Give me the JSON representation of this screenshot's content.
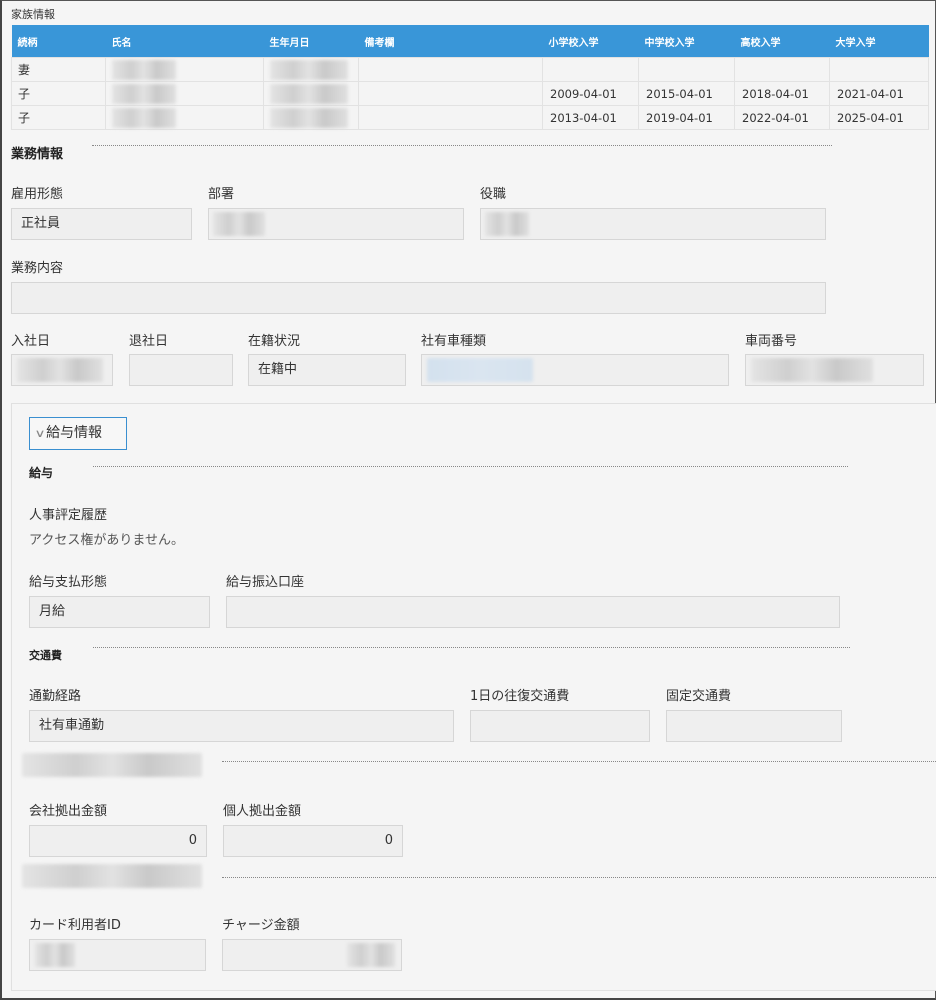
{
  "family": {
    "caption": "家族情報",
    "headers": [
      "続柄",
      "氏名",
      "生年月日",
      "備考欄",
      "小学校入学",
      "中学校入学",
      "高校入学",
      "大学入学"
    ],
    "rows": [
      {
        "relation": "妻",
        "name": "",
        "birthdate": "",
        "note": "",
        "elementary": "",
        "junior_high": "",
        "high_school": "",
        "university": ""
      },
      {
        "relation": "子",
        "name": "",
        "birthdate": "",
        "note": "",
        "elementary": "2009-04-01",
        "junior_high": "2015-04-01",
        "high_school": "2018-04-01",
        "university": "2021-04-01"
      },
      {
        "relation": "子",
        "name": "",
        "birthdate": "",
        "note": "",
        "elementary": "2013-04-01",
        "junior_high": "2019-04-01",
        "high_school": "2022-04-01",
        "university": "2025-04-01"
      }
    ]
  },
  "work": {
    "title": "業務情報",
    "employment_type": {
      "label": "雇用形態",
      "value": "正社員"
    },
    "department": {
      "label": "部署",
      "value": ""
    },
    "position": {
      "label": "役職",
      "value": ""
    },
    "job_description": {
      "label": "業務内容",
      "value": ""
    },
    "hire_date": {
      "label": "入社日",
      "value": ""
    },
    "leave_date": {
      "label": "退社日",
      "value": ""
    },
    "status": {
      "label": "在籍状況",
      "value": "在籍中"
    },
    "company_car_type": {
      "label": "社有車種類",
      "value": ""
    },
    "vehicle_number": {
      "label": "車両番号",
      "value": ""
    }
  },
  "salary_panel": {
    "toggle_label": "給与情報",
    "salary": {
      "title": "給与",
      "evaluation_history": {
        "label": "人事評定履歴",
        "message": "アクセス権がありません。"
      },
      "payment_type": {
        "label": "給与支払形態",
        "value": "月給"
      },
      "bank_account": {
        "label": "給与振込口座",
        "value": ""
      }
    },
    "transport": {
      "title": "交通費",
      "route": {
        "label": "通勤経路",
        "value": "社有車通勤"
      },
      "daily_round_trip": {
        "label": "1日の往復交通費",
        "value": ""
      },
      "fixed_fee": {
        "label": "固定交通費",
        "value": ""
      }
    },
    "contribution": {
      "company_amount": {
        "label": "会社拠出金額",
        "value": "0"
      },
      "personal_amount": {
        "label": "個人拠出金額",
        "value": "0"
      }
    },
    "card": {
      "user_id": {
        "label": "カード利用者ID",
        "value": ""
      },
      "charge_amount": {
        "label": "チャージ金額",
        "value": ""
      }
    }
  }
}
